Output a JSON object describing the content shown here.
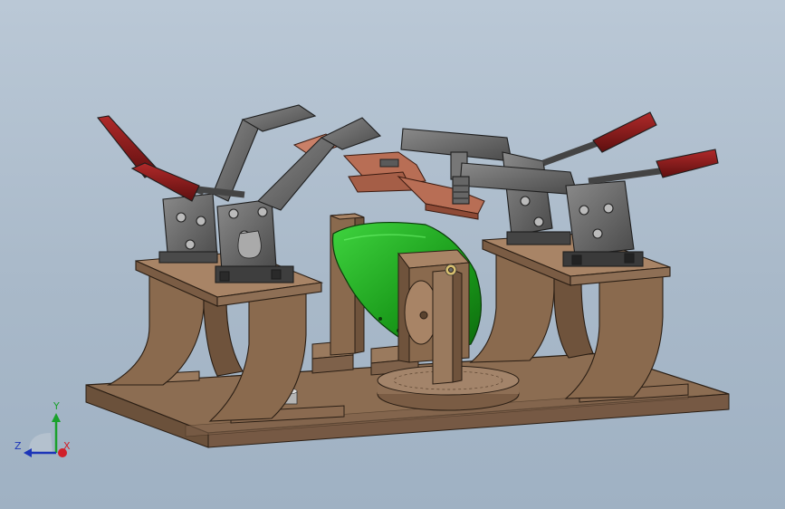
{
  "triad": {
    "y_label": "Y",
    "z_label": "Z",
    "x_label": "X",
    "colors": {
      "x": "#d0202a",
      "y": "#1aa12c",
      "z": "#1c35b8"
    }
  },
  "model": {
    "icons": [
      "toggle-clamp-icon",
      "cad-assembly-icon"
    ],
    "colors": {
      "wood": "#8a6a4e",
      "wood_light": "#a88466",
      "steel": "#6f6f6f",
      "handle": "#8e1b1b",
      "copper": "#b86e55",
      "green_part": "#1f9a1f"
    }
  }
}
